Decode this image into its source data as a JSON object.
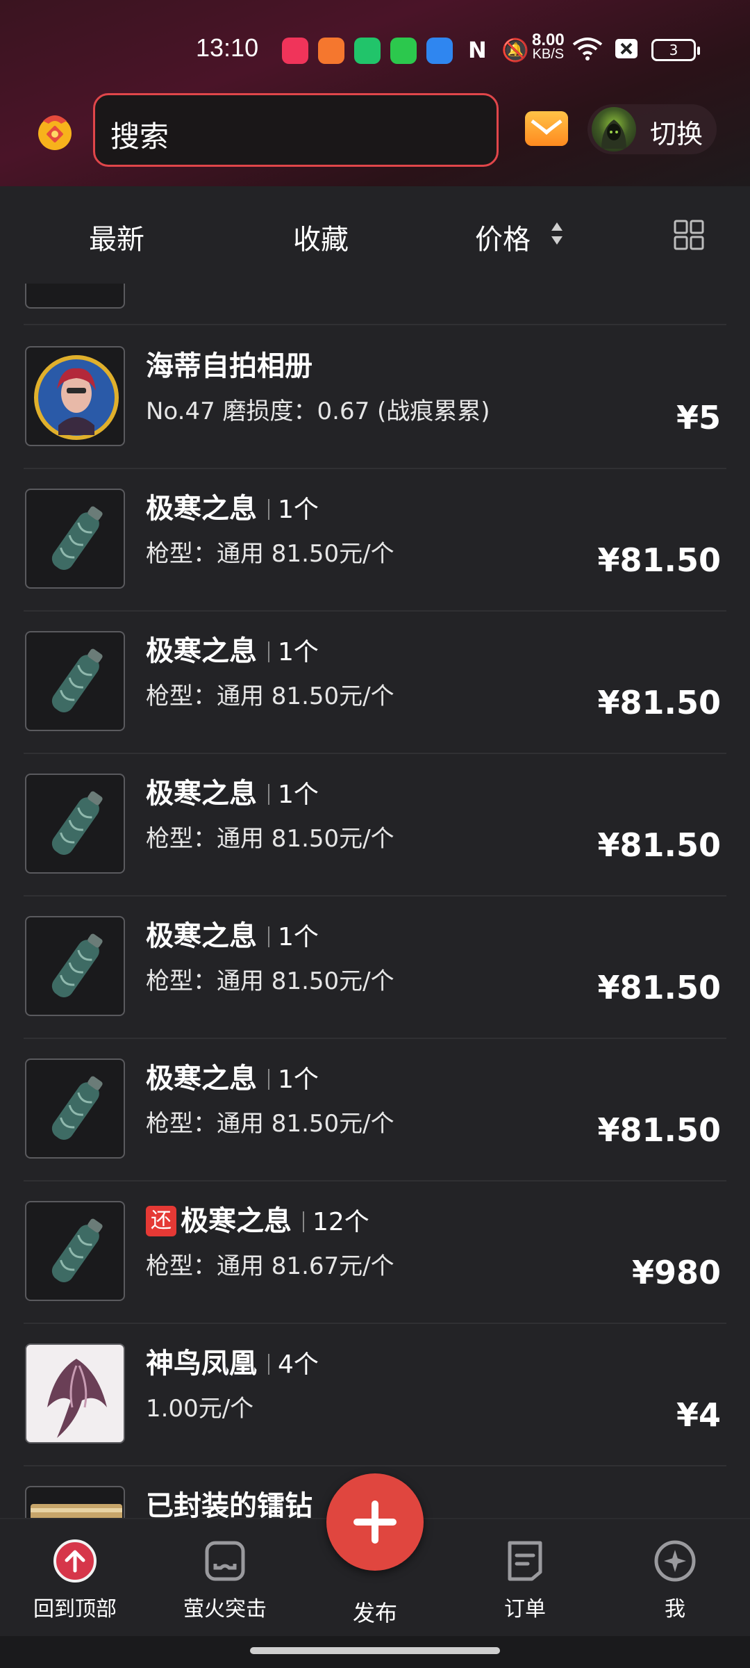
{
  "status": {
    "time": "13:10",
    "net_speed_value": "8.00",
    "net_speed_unit": "KB/S",
    "battery": "3"
  },
  "header": {
    "search_placeholder": "搜索",
    "switch_label": "切换"
  },
  "sort": {
    "latest": "最新",
    "favorites": "收藏",
    "price": "价格"
  },
  "items": [
    {
      "title": "海蒂自拍相册",
      "qty": "",
      "sub": "No.47 磨损度：0.67 (战痕累累)",
      "price": "¥5",
      "badge": "",
      "thumb": "portrait"
    },
    {
      "title": "极寒之息",
      "qty": "1个",
      "sub": "枪型：通用 81.50元/个",
      "price": "¥81.50",
      "badge": "",
      "thumb": "canister"
    },
    {
      "title": "极寒之息",
      "qty": "1个",
      "sub": "枪型：通用 81.50元/个",
      "price": "¥81.50",
      "badge": "",
      "thumb": "canister"
    },
    {
      "title": "极寒之息",
      "qty": "1个",
      "sub": "枪型：通用 81.50元/个",
      "price": "¥81.50",
      "badge": "",
      "thumb": "canister"
    },
    {
      "title": "极寒之息",
      "qty": "1个",
      "sub": "枪型：通用 81.50元/个",
      "price": "¥81.50",
      "badge": "",
      "thumb": "canister"
    },
    {
      "title": "极寒之息",
      "qty": "1个",
      "sub": "枪型：通用 81.50元/个",
      "price": "¥81.50",
      "badge": "",
      "thumb": "canister"
    },
    {
      "title": "极寒之息",
      "qty": "12个",
      "sub": "枪型：通用 81.67元/个",
      "price": "¥980",
      "badge": "还",
      "thumb": "canister"
    },
    {
      "title": "神鸟凤凰",
      "qty": "4个",
      "sub": "1.00元/个",
      "price": "¥4",
      "badge": "",
      "thumb": "phoenix"
    },
    {
      "title": "已封装的镭钻",
      "qty": "",
      "sub": "",
      "price": "",
      "badge": "",
      "thumb": "gold"
    }
  ],
  "nav": {
    "back_to_top": "回到顶部",
    "game": "萤火突击",
    "publish": "发布",
    "orders": "订单",
    "me": "我"
  }
}
